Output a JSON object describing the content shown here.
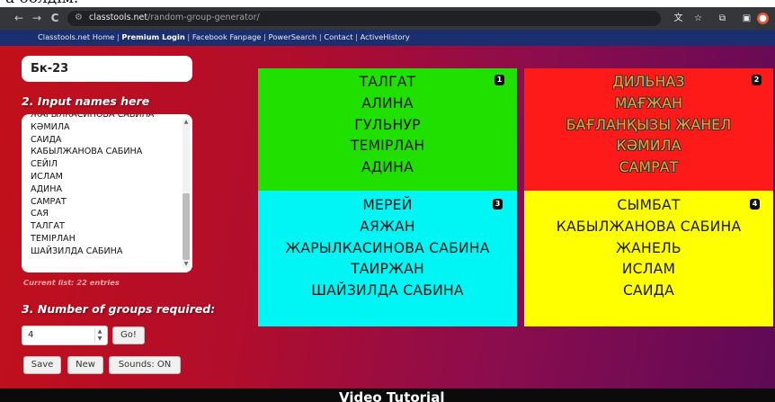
{
  "caption_fragment": "а бөлдім.",
  "browser": {
    "back": "←",
    "forward": "→",
    "reload": "C",
    "url_host": "classtools.net",
    "url_path": "/random-group-generator/"
  },
  "top_links": [
    {
      "label": "Classtools.net Home"
    },
    {
      "label": "Premium Login"
    },
    {
      "label": "Facebook Fanpage"
    },
    {
      "label": "PowerSearch"
    },
    {
      "label": "Contact"
    },
    {
      "label": "ActiveHistory"
    }
  ],
  "panel": {
    "group_name_value": "Бк-23",
    "step2_heading": "2. Input names here",
    "names": [
      "ЖАРЫЛКАСИНОВА САБИНА",
      "КӘМИЛА",
      "САИДА",
      "КАБЫЛЖАНОВА САБИНА",
      "СЕЙІЛ",
      "ИСЛАМ",
      "АДИНА",
      "САМРАТ",
      "САЯ",
      "ТАЛГАТ",
      "ТЕМІРЛАН",
      "ШАЙЗИЛДА САБИНА"
    ],
    "current_list": "Current list: 22 entries",
    "step3_heading": "3. Number of groups required:",
    "group_count_value": "4",
    "go_label": "Go!",
    "save_label": "Save",
    "new_label": "New",
    "sounds_label": "Sounds: ON"
  },
  "groups": [
    {
      "number": "1",
      "color": "#20e000",
      "names": [
        "ТАЛГАТ",
        "АЛИНА",
        "ГУЛЬНУР",
        "ТЕМІРЛАН",
        "АДИНА"
      ]
    },
    {
      "number": "2",
      "color": "#ff1a1a",
      "names": [
        "ДИЛЬНАЗ",
        "МАҒЖАН",
        "БАҒЛАНҚЫЗЫ ЖАНЕЛ",
        "КӘМИЛА",
        "САМРАТ"
      ]
    },
    {
      "number": "3",
      "color": "#00f5f5",
      "names": [
        "МЕРЕЙ",
        "АЯЖАН",
        "ЖАРЫЛКАСИНОВА САБИНА",
        "ТАИРЖАН",
        "ШАЙЗИЛДА САБИНА"
      ]
    },
    {
      "number": "4",
      "color": "#ffff00",
      "names": [
        "СЫМБАТ",
        "КАБЫЛЖАНОВА САБИНА",
        "ЖАНЕЛЬ",
        "ИСЛАМ",
        "САИДА"
      ]
    }
  ],
  "video_tutorial": "Video Tutorial",
  "colors": {
    "chrome": "#35363a",
    "link_bar": "#1b2f6e",
    "page_gradient_start": "#c2101a",
    "page_gradient_end": "#5e0a57"
  },
  "icons": [
    "back-arrow-icon",
    "forward-arrow-icon",
    "reload-icon",
    "site-settings-icon",
    "translate-icon",
    "star-icon",
    "extensions-icon",
    "sidebar-icon",
    "profile-icon"
  ]
}
